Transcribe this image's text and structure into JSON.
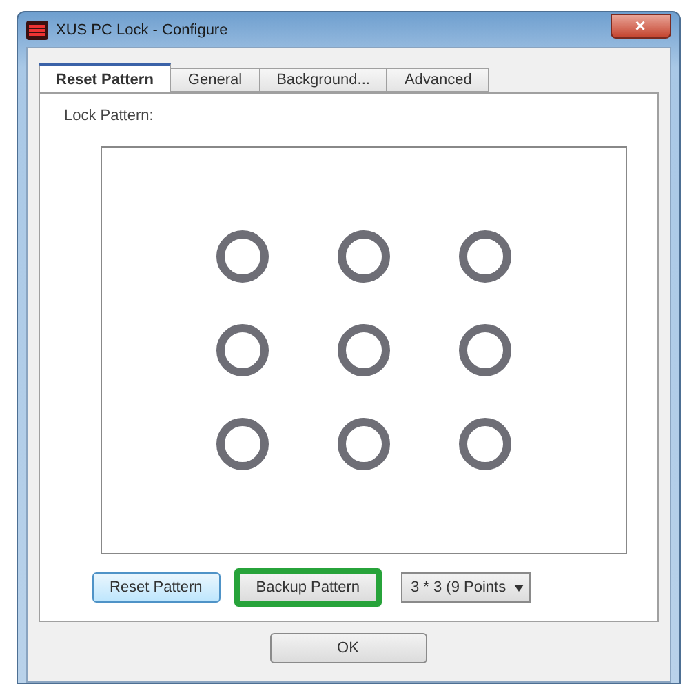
{
  "window": {
    "title": "XUS PC Lock - Configure",
    "close": "×"
  },
  "tabs": [
    {
      "label": "Reset Pattern",
      "selected": true
    },
    {
      "label": "General",
      "selected": false
    },
    {
      "label": "Background...",
      "selected": false
    },
    {
      "label": "Advanced",
      "selected": false
    }
  ],
  "panel": {
    "label": "Lock Pattern:"
  },
  "buttons": [
    {
      "kind": "button",
      "label": "Reset Pattern",
      "highlighted": false,
      "focused": true
    },
    {
      "kind": "button",
      "label": "Backup Pattern",
      "highlighted": true,
      "focused": false
    },
    {
      "kind": "dropdown",
      "label": "3 * 3 (9 Points"
    }
  ],
  "footer": {
    "ok": "OK"
  }
}
